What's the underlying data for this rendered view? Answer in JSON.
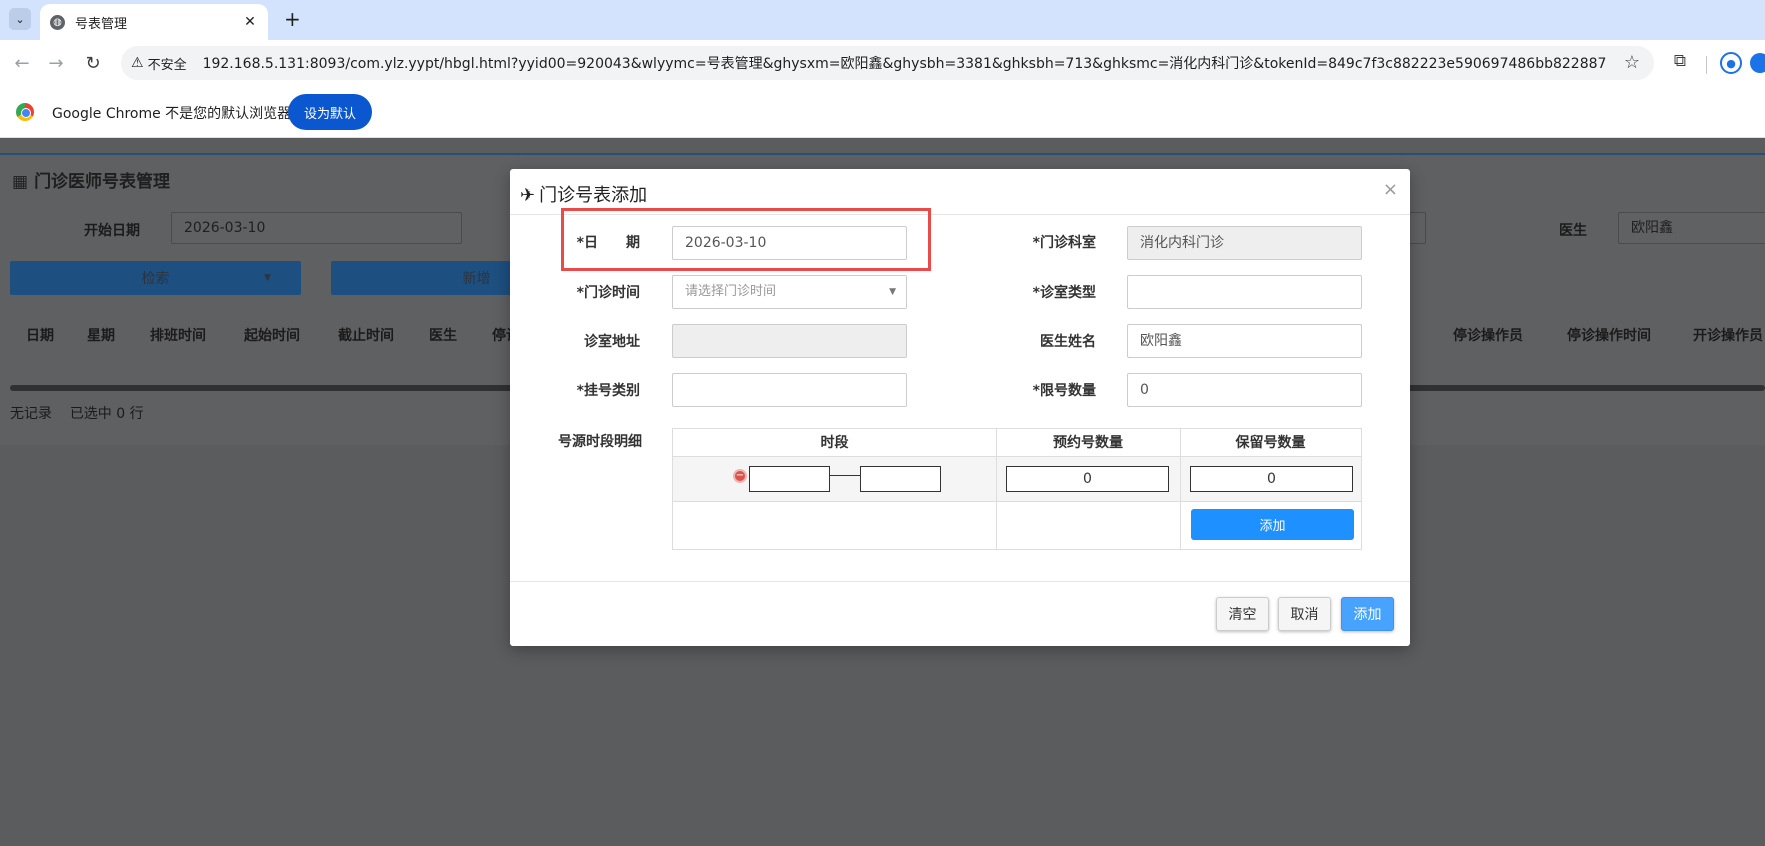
{
  "browser": {
    "tab_title": "号表管理",
    "new_tab_glyph": "+",
    "insecure_label": "不安全",
    "url": "192.168.5.131:8093/com.ylz.yypt/hbgl.html?yyid00=920043&wlyymc=号表管理&ghysxm=欧阳鑫&ghysbh=3381&ghksbh=713&ghksmc=消化内科门诊&tokenId=849c7f3c882223e590697486bb822887",
    "infobar_text": "Google Chrome 不是您的默认浏览器",
    "set_default_label": "设为默认"
  },
  "page": {
    "title": "门诊医师号表管理",
    "start_date_label": "开始日期",
    "start_date_value": "2026-03-10",
    "doctor_label": "医生",
    "doctor_value": "欧阳鑫",
    "search_label": "检索",
    "add_label": "新增",
    "columns_left": [
      "日期",
      "星期",
      "排班时间",
      "起始时间",
      "截止时间",
      "医生",
      "停诊"
    ],
    "columns_right": [
      "停诊操作员",
      "停诊操作时间",
      "开诊操作员"
    ],
    "status_no_record": "无记录",
    "status_selected": "已选中 0 行"
  },
  "modal": {
    "title": "门诊号表添加",
    "close_glyph": "×",
    "fields": {
      "date_label": "*日　　期",
      "date_value": "2026-03-10",
      "dept_label": "*门诊科室",
      "dept_value": "消化内科门诊",
      "time_label": "*门诊时间",
      "time_placeholder": "请选择门诊时间",
      "room_type_label": "*诊室类型",
      "room_type_value": "",
      "room_addr_label": "诊室地址",
      "room_addr_value": "",
      "doctor_label": "医生姓名",
      "doctor_value": "欧阳鑫",
      "reg_type_label": "*挂号类别",
      "reg_type_value": "",
      "limit_label": "*限号数量",
      "limit_value": "0",
      "slot_detail_label": "号源时段明细"
    },
    "slot_table": {
      "headers": [
        "时段",
        "预约号数量",
        "保留号数量"
      ],
      "row": {
        "start": "",
        "end": "",
        "booked": "0",
        "reserved": "0"
      },
      "add_row_label": "添加"
    },
    "footer": {
      "clear_label": "清空",
      "cancel_label": "取消",
      "submit_label": "添加"
    }
  },
  "colors": {
    "highlight_border": "#e94a4a",
    "primary_button": "#1e90ff",
    "chrome_tabbar": "#d3e3fd"
  }
}
